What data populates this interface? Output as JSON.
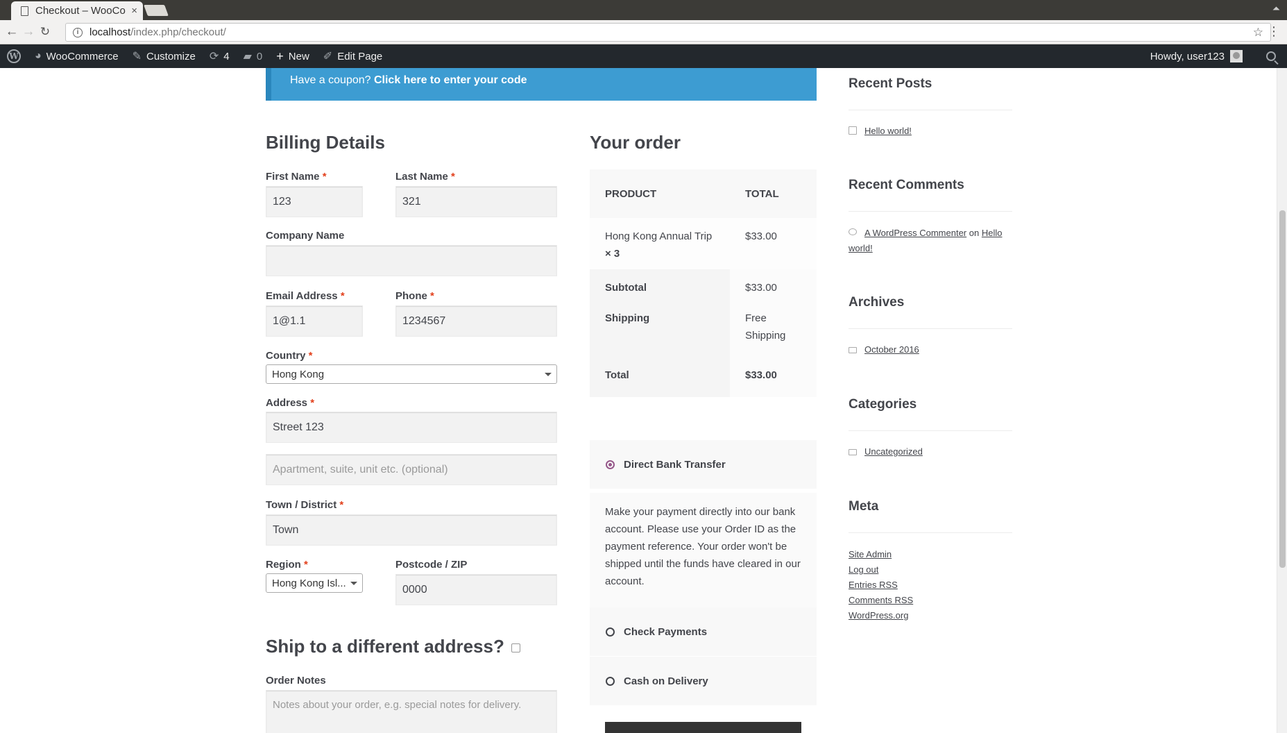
{
  "browser": {
    "tab_title": "Checkout – WooCo",
    "tab_close": "×",
    "url_host": "localhost",
    "url_path": "/index.php/checkout/"
  },
  "adminbar": {
    "woocommerce": "WooCommerce",
    "customize": "Customize",
    "updates_count": "4",
    "comments_count": "0",
    "new_label": "New",
    "edit_page": "Edit Page",
    "howdy": "Howdy, user123"
  },
  "coupon": {
    "prefix": "Have a coupon?",
    "link": "Click here to enter your code"
  },
  "billing": {
    "title": "Billing Details",
    "first_name_label": "First Name",
    "first_name_value": "123",
    "last_name_label": "Last Name",
    "last_name_value": "321",
    "company_label": "Company Name",
    "company_value": "",
    "email_label": "Email Address",
    "email_value": "1@1.1",
    "phone_label": "Phone",
    "phone_value": "1234567",
    "country_label": "Country",
    "country_value": "Hong Kong",
    "address_label": "Address",
    "address_value": "Street 123",
    "address2_placeholder": "Apartment, suite, unit etc. (optional)",
    "town_label": "Town / District",
    "town_value": "Town",
    "region_label": "Region",
    "region_value": "Hong Kong Isl...",
    "postcode_label": "Postcode / ZIP",
    "postcode_value": "0000",
    "required_mark": "*"
  },
  "shipping": {
    "title": "Ship to a different address?",
    "notes_label": "Order Notes",
    "notes_placeholder": "Notes about your order, e.g. special notes for delivery."
  },
  "order": {
    "title": "Your order",
    "col_product": "PRODUCT",
    "col_total": "TOTAL",
    "item_name": "Hong Kong Annual Trip",
    "item_qty": "× 3",
    "item_total": "$33.00",
    "subtotal_label": "Subtotal",
    "subtotal_value": "$33.00",
    "shipping_label": "Shipping",
    "shipping_value": "Free Shipping",
    "total_label": "Total",
    "total_value": "$33.00"
  },
  "payment": {
    "bank_transfer": "Direct Bank Transfer",
    "bank_desc": "Make your payment directly into our bank account. Please use your Order ID as the payment reference. Your order won't be shipped until the funds have cleared in our account.",
    "check": "Check Payments",
    "cod": "Cash on Delivery",
    "selected": "Direct Bank Transfer"
  },
  "sidebar": {
    "recent_posts_title": "Recent Posts",
    "recent_post": "Hello world!",
    "recent_comments_title": "Recent Comments",
    "commenter": "A WordPress Commenter",
    "comment_on": "on",
    "comment_post": "Hello world!",
    "archives_title": "Archives",
    "archive": "October 2016",
    "categories_title": "Categories",
    "category": "Uncategorized",
    "meta_title": "Meta",
    "meta_links": [
      "Site Admin",
      "Log out",
      "Entries RSS",
      "Comments RSS",
      "WordPress.org"
    ]
  },
  "colors": {
    "coupon_bg": "#3d9cd2",
    "adminbar_bg": "#23282d",
    "required": "#e2401c",
    "radio_selected": "#96588a"
  }
}
